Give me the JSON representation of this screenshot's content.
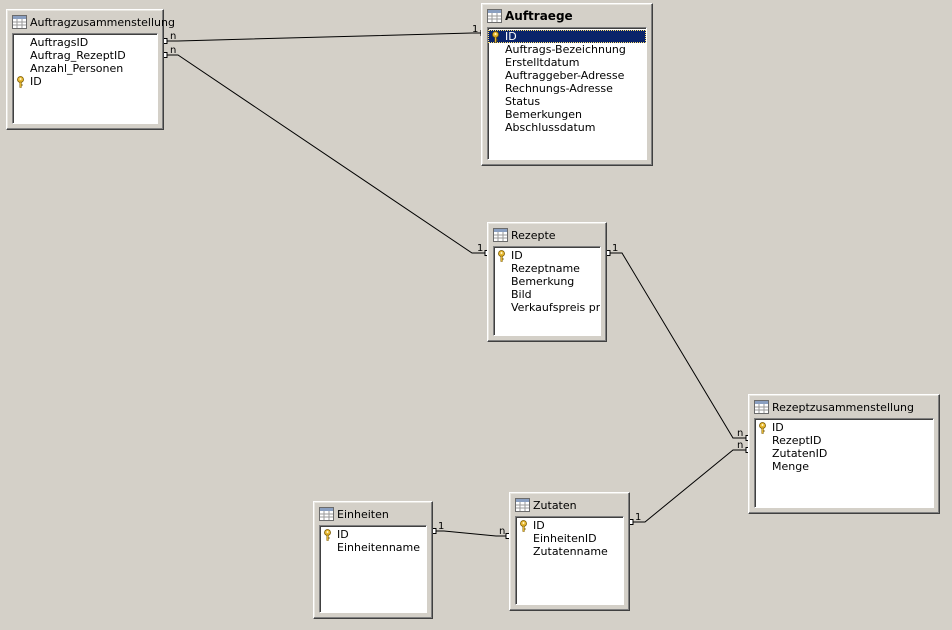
{
  "tables": {
    "auftragzusammenstellung": {
      "title": "Auftragzusammenstellung",
      "fields": [
        {
          "name": "AuftragsID",
          "key": false
        },
        {
          "name": "Auftrag_RezeptID",
          "key": false
        },
        {
          "name": "Anzahl_Personen",
          "key": false
        },
        {
          "name": "ID",
          "key": true
        }
      ]
    },
    "auftraege": {
      "title": "Auftraege",
      "fields": [
        {
          "name": "ID",
          "key": true,
          "selected": true
        },
        {
          "name": "Auftrags-Bezeichnung",
          "key": false
        },
        {
          "name": "Erstelltdatum",
          "key": false
        },
        {
          "name": "Auftraggeber-Adresse",
          "key": false
        },
        {
          "name": "Rechnungs-Adresse",
          "key": false
        },
        {
          "name": "Status",
          "key": false
        },
        {
          "name": "Bemerkungen",
          "key": false
        },
        {
          "name": "Abschlussdatum",
          "key": false
        }
      ]
    },
    "rezepte": {
      "title": "Rezepte",
      "fields": [
        {
          "name": "ID",
          "key": true
        },
        {
          "name": "Rezeptname",
          "key": false
        },
        {
          "name": "Bemerkung",
          "key": false
        },
        {
          "name": "Bild",
          "key": false
        },
        {
          "name": "Verkaufspreis pro P",
          "key": false
        }
      ]
    },
    "rezeptzusammenstellung": {
      "title": "Rezeptzusammenstellung",
      "fields": [
        {
          "name": "ID",
          "key": true
        },
        {
          "name": "RezeptID",
          "key": false
        },
        {
          "name": "ZutatenID",
          "key": false
        },
        {
          "name": "Menge",
          "key": false
        }
      ]
    },
    "einheiten": {
      "title": "Einheiten",
      "fields": [
        {
          "name": "ID",
          "key": true
        },
        {
          "name": "Einheitenname",
          "key": false
        }
      ]
    },
    "zutaten": {
      "title": "Zutaten",
      "fields": [
        {
          "name": "ID",
          "key": true
        },
        {
          "name": "EinheitenID",
          "key": false
        },
        {
          "name": "Zutatenname",
          "key": false
        }
      ]
    }
  },
  "relations": [
    {
      "from": "auftragzusammenstellung",
      "to": "auftraege",
      "from_card": "n",
      "to_card": "1"
    },
    {
      "from": "auftragzusammenstellung",
      "to": "rezepte",
      "from_card": "n",
      "to_card": "1"
    },
    {
      "from": "rezepte",
      "to": "rezeptzusammenstellung",
      "from_card": "1",
      "to_card": "n"
    },
    {
      "from": "zutaten",
      "to": "rezeptzusammenstellung",
      "from_card": "1",
      "to_card": "n"
    },
    {
      "from": "einheiten",
      "to": "zutaten",
      "from_card": "1",
      "to_card": "n"
    }
  ],
  "colors": {
    "background": "#d4d0c8",
    "selection": "#0a246a",
    "key_icon": "#e8b830"
  },
  "icons": {
    "table": "table-grid-icon",
    "primary_key": "key-icon"
  }
}
